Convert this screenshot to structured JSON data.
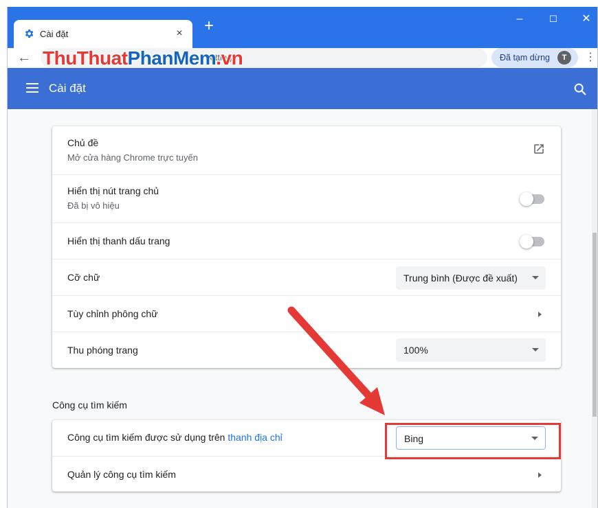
{
  "browser": {
    "tab_title": "Cài đặt",
    "tab_close": "×",
    "new_tab": "+",
    "window_controls": {
      "minimize": "–",
      "maximize": "☐",
      "close": "✕"
    },
    "omnibox_text": "settings",
    "profile_status": "Đã tạm dừng",
    "avatar_letter": "T",
    "menu": "⋮"
  },
  "watermark": {
    "part1": "ThuThuat",
    "part2": "PhanMem",
    "part3": ".vn"
  },
  "settings": {
    "title": "Cài đặt",
    "appearance": {
      "rows": [
        {
          "label": "Chủ đề",
          "sub": "Mở cửa hàng Chrome trực tuyến"
        },
        {
          "label": "Hiển thị nút trang chủ",
          "sub": "Đã bị vô hiệu",
          "toggle_on": false
        },
        {
          "label": "Hiển thị thanh dấu trang",
          "toggle_on": false
        },
        {
          "label": "Cỡ chữ",
          "value": "Trung bình (Được đề xuất)"
        },
        {
          "label": "Tùy chỉnh phông chữ"
        },
        {
          "label": "Thu phóng trang",
          "value": "100%"
        }
      ]
    },
    "search": {
      "section_title": "Công cụ tìm kiếm",
      "engine_label": "Công cụ tìm kiếm được sử dụng trên ",
      "engine_link": "thanh địa chỉ",
      "engine_value": "Bing",
      "manage_label": "Quản lý công cụ tìm kiếm"
    }
  },
  "colors": {
    "titlebar": "#2a73e8",
    "appbar": "#3c6fd6",
    "highlight": "#e53935",
    "link": "#1a73e8"
  }
}
